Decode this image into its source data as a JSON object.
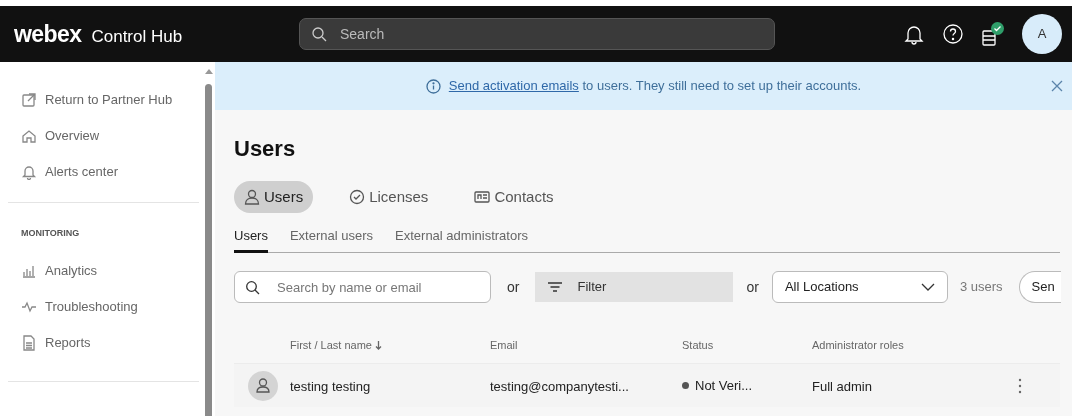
{
  "header": {
    "logo": "webex",
    "product": "Control Hub",
    "search": {
      "placeholder": "Search"
    },
    "avatar": "A",
    "tasks_done": true
  },
  "sidebar": {
    "groups": [
      {
        "items": [
          {
            "label": "Return to Partner Hub"
          },
          {
            "label": "Overview"
          },
          {
            "label": "Alerts center"
          }
        ]
      },
      {
        "heading": "MONITORING",
        "items": [
          {
            "label": "Analytics"
          },
          {
            "label": "Troubleshooting"
          },
          {
            "label": "Reports"
          }
        ]
      }
    ]
  },
  "banner": {
    "link": "Send activation emails",
    "text": " to users. They still need to set up their accounts."
  },
  "page_title": "Users",
  "tabs": [
    {
      "label": "Users",
      "selected": true
    },
    {
      "label": "Licenses",
      "selected": false
    },
    {
      "label": "Contacts",
      "selected": false
    }
  ],
  "subtabs": [
    {
      "label": "Users",
      "selected": true
    },
    {
      "label": "External users",
      "selected": false
    },
    {
      "label": "External administrators",
      "selected": false
    }
  ],
  "toolbar": {
    "search": {
      "placeholder": "Search by name or email"
    },
    "or_1": "or",
    "filter": "Filter",
    "or_2": "or",
    "location": "All Locations",
    "count": "3 users",
    "button": "Sen"
  },
  "table": {
    "columns": [
      "First / Last name",
      "Email",
      "Status",
      "Administrator roles"
    ],
    "rows": [
      {
        "name": "testing testing",
        "email": "testing@companytesti...",
        "status": "Not Veri...",
        "roles": "Full admin"
      }
    ]
  }
}
